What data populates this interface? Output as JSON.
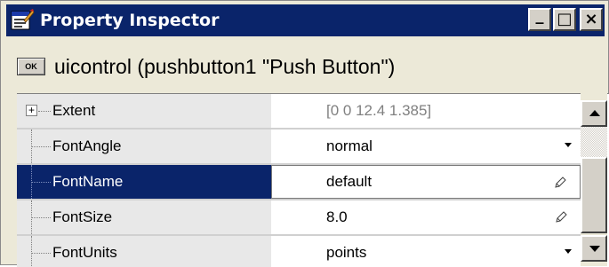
{
  "window": {
    "title": "Property Inspector",
    "title_icon": "property-inspector-icon",
    "buttons": [
      "minimize",
      "maximize",
      "close"
    ],
    "button_glyphs": {
      "minimize": "_",
      "maximize": "□",
      "close": "×"
    }
  },
  "header": {
    "icon_label": "OK",
    "text": "uicontrol (pushbutton1 \"Push Button\")"
  },
  "properties": [
    {
      "name": "Extent",
      "value": "[0 0 12.4 1.385]",
      "expandable": true,
      "muted": true,
      "control": "none"
    },
    {
      "name": "FontAngle",
      "value": "normal",
      "control": "dropdown"
    },
    {
      "name": "FontName",
      "value": "default",
      "selected": true,
      "control": "edit"
    },
    {
      "name": "FontSize",
      "value": "8.0",
      "control": "edit"
    },
    {
      "name": "FontUnits",
      "value": "points",
      "control": "dropdown"
    }
  ],
  "colors": {
    "titlebar": "#0a246a",
    "selection": "#0a246a",
    "name_cell": "#e8e8e8",
    "muted_text": "#808080"
  }
}
